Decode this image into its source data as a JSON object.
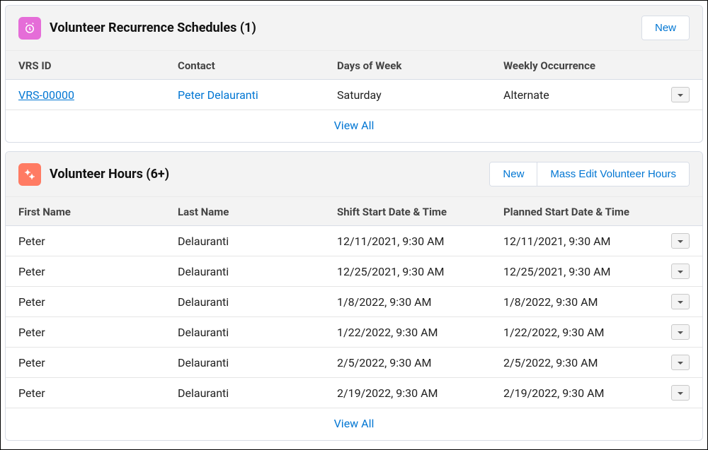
{
  "card1": {
    "title": "Volunteer Recurrence Schedules (1)",
    "new_label": "New",
    "view_all": "View All",
    "columns": [
      "VRS ID",
      "Contact",
      "Days of Week",
      "Weekly Occurrence"
    ],
    "rows": [
      {
        "id": "VRS-00000",
        "contact": "Peter Delauranti",
        "days": "Saturday",
        "occurrence": "Alternate"
      }
    ]
  },
  "card2": {
    "title": "Volunteer Hours (6+)",
    "new_label": "New",
    "mass_edit_label": "Mass Edit Volunteer Hours",
    "view_all": "View All",
    "columns": [
      "First Name",
      "Last Name",
      "Shift Start Date & Time",
      "Planned Start Date & Time"
    ],
    "rows": [
      {
        "first": "Peter",
        "last": "Delauranti",
        "shift": "12/11/2021, 9:30 AM",
        "planned": "12/11/2021, 9:30 AM"
      },
      {
        "first": "Peter",
        "last": "Delauranti",
        "shift": "12/25/2021, 9:30 AM",
        "planned": "12/25/2021, 9:30 AM"
      },
      {
        "first": "Peter",
        "last": "Delauranti",
        "shift": "1/8/2022, 9:30 AM",
        "planned": "1/8/2022, 9:30 AM"
      },
      {
        "first": "Peter",
        "last": "Delauranti",
        "shift": "1/22/2022, 9:30 AM",
        "planned": "1/22/2022, 9:30 AM"
      },
      {
        "first": "Peter",
        "last": "Delauranti",
        "shift": "2/5/2022, 9:30 AM",
        "planned": "2/5/2022, 9:30 AM"
      },
      {
        "first": "Peter",
        "last": "Delauranti",
        "shift": "2/19/2022, 9:30 AM",
        "planned": "2/19/2022, 9:30 AM"
      }
    ]
  }
}
